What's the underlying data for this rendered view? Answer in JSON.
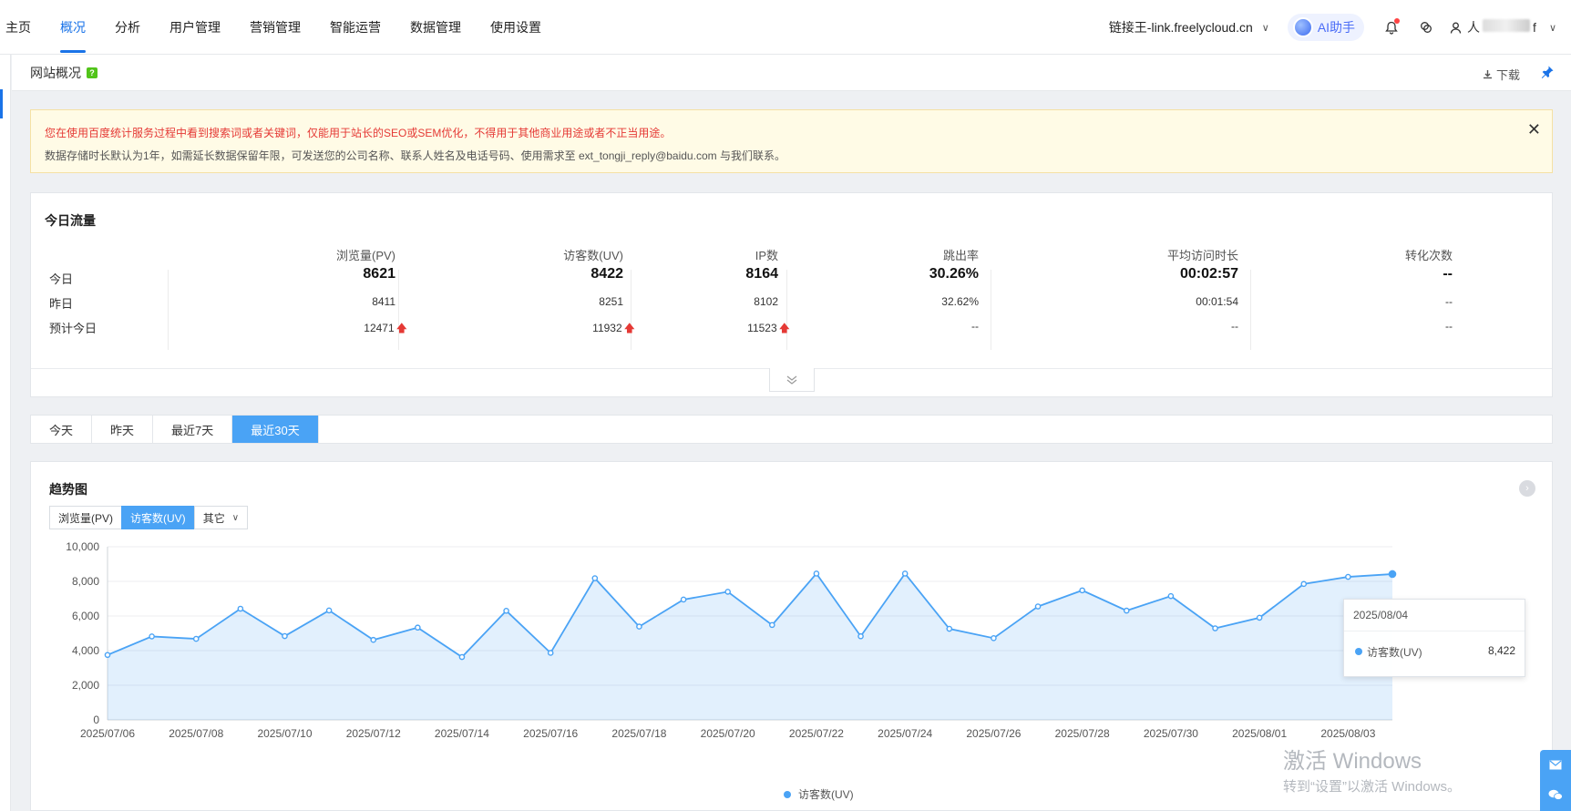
{
  "nav": {
    "items": [
      {
        "label": "主页",
        "active": false
      },
      {
        "label": "概况",
        "active": true
      },
      {
        "label": "分析",
        "active": false
      },
      {
        "label": "用户管理",
        "active": false
      },
      {
        "label": "营销管理",
        "active": false
      },
      {
        "label": "智能运营",
        "active": false
      },
      {
        "label": "数据管理",
        "active": false
      },
      {
        "label": "使用设置",
        "active": false
      }
    ],
    "site": "链接王-link.freelycloud.cn",
    "ai_label": "AI助手",
    "user_suffix": "f",
    "user_prefix": "人"
  },
  "subheader": {
    "title": "网站概况",
    "help": "?",
    "download": "下载"
  },
  "alert": {
    "line1": "您在使用百度统计服务过程中看到搜索词或者关键词，仅能用于站长的SEO或SEM优化，不得用于其他商业用途或者不正当用途。",
    "line2": "数据存储时长默认为1年，如需延长数据保留年限，可发送您的公司名称、联系人姓名及电话号码、使用需求至 ext_tongji_reply@baidu.com 与我们联系。"
  },
  "today": {
    "title": "今日流量",
    "headers": [
      "浏览量(PV)",
      "访客数(UV)",
      "IP数",
      "跳出率",
      "平均访问时长",
      "转化次数"
    ],
    "rows": [
      {
        "label": "今日",
        "values": [
          "8621",
          "8422",
          "8164",
          "30.26%",
          "00:02:57",
          "--"
        ]
      },
      {
        "label": "昨日",
        "values": [
          "8411",
          "8251",
          "8102",
          "32.62%",
          "00:01:54",
          "--"
        ]
      },
      {
        "label": "预计今日",
        "values": [
          "12471",
          "11932",
          "11523",
          "--",
          "--",
          "--"
        ]
      }
    ]
  },
  "range_tabs": [
    {
      "label": "今天",
      "active": false
    },
    {
      "label": "昨天",
      "active": false
    },
    {
      "label": "最近7天",
      "active": false
    },
    {
      "label": "最近30天",
      "active": true
    }
  ],
  "trend": {
    "title": "趋势图",
    "metric_tabs": [
      {
        "label": "浏览量(PV)",
        "active": false
      },
      {
        "label": "访客数(UV)",
        "active": true
      },
      {
        "label": "其它",
        "active": false
      }
    ],
    "tooltip": {
      "date": "2025/08/04",
      "series": "访客数(UV)",
      "value": "8,422"
    }
  },
  "chart_data": {
    "type": "area",
    "x": [
      "2025/07/06",
      "2025/07/07",
      "2025/07/08",
      "2025/07/09",
      "2025/07/10",
      "2025/07/11",
      "2025/07/12",
      "2025/07/13",
      "2025/07/14",
      "2025/07/15",
      "2025/07/16",
      "2025/07/17",
      "2025/07/18",
      "2025/07/19",
      "2025/07/20",
      "2025/07/21",
      "2025/07/22",
      "2025/07/23",
      "2025/07/24",
      "2025/07/25",
      "2025/07/26",
      "2025/07/27",
      "2025/07/28",
      "2025/07/29",
      "2025/07/30",
      "2025/07/31",
      "2025/08/01",
      "2025/08/02",
      "2025/08/03",
      "2025/08/04"
    ],
    "series": [
      {
        "name": "访客数(UV)",
        "values": [
          3750,
          4820,
          4680,
          6420,
          4840,
          6320,
          4620,
          5330,
          3630,
          6300,
          3870,
          8180,
          5390,
          6950,
          7400,
          5480,
          8450,
          4830,
          8450,
          5260,
          4720,
          6550,
          7480,
          6310,
          7150,
          5290,
          5900,
          7850,
          8260,
          8422
        ]
      }
    ],
    "xticks": [
      "2025/07/06",
      "2025/07/08",
      "2025/07/10",
      "2025/07/12",
      "2025/07/14",
      "2025/07/16",
      "2025/07/18",
      "2025/07/20",
      "2025/07/22",
      "2025/07/24",
      "2025/07/26",
      "2025/07/28",
      "2025/07/30",
      "2025/08/01",
      "2025/08/03"
    ],
    "yticks": [
      "0",
      "2,000",
      "4,000",
      "6,000",
      "8,000",
      "10,000"
    ],
    "ylim": [
      0,
      10000
    ],
    "color": "#4aa3f5",
    "grid": true,
    "legend": "bottom-center"
  },
  "watermark": {
    "line1": "激活 Windows",
    "line2": "转到“设置”以激活 Windows。"
  }
}
